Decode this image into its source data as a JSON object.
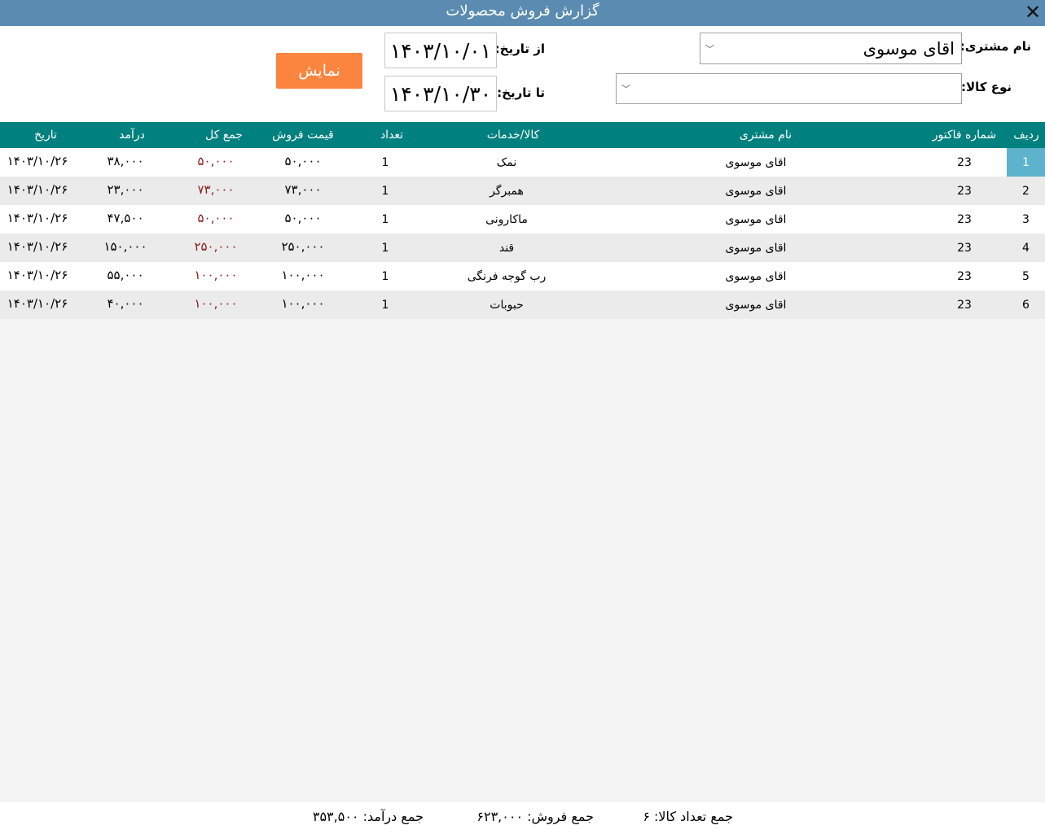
{
  "window": {
    "title": "گزارش فروش محصولات"
  },
  "filters": {
    "customer_label": "نام مشتری:",
    "customer_value": "اقای موسوی",
    "product_type_label": "نوع کالا:",
    "product_type_value": "",
    "from_date_label": "از تاریخ:",
    "from_date_value": "۱۴۰۳/۱۰/۰۱",
    "to_date_label": "تا تاریخ:",
    "to_date_value": "۱۴۰۳/۱۰/۳۰",
    "show_button": "نمایش"
  },
  "table": {
    "columns": {
      "row": "ردیف",
      "invoice": "شماره فاکتور",
      "customer": "نام مشتری",
      "product": "کالا/خدمات",
      "qty": "تعداد",
      "price": "قیمت فروش",
      "total": "جمع کل",
      "income": "درآمد",
      "date": "تاریخ"
    },
    "rows": [
      {
        "row": "1",
        "invoice": "23",
        "customer": "اقای موسوی",
        "product": "نمک",
        "qty": "1",
        "price": "۵۰,۰۰۰",
        "total": "۵۰,۰۰۰",
        "income": "۳۸,۰۰۰",
        "date": "۱۴۰۳/۱۰/۲۶"
      },
      {
        "row": "2",
        "invoice": "23",
        "customer": "اقای موسوی",
        "product": "همبرگر",
        "qty": "1",
        "price": "۷۳,۰۰۰",
        "total": "۷۳,۰۰۰",
        "income": "۲۳,۰۰۰",
        "date": "۱۴۰۳/۱۰/۲۶"
      },
      {
        "row": "3",
        "invoice": "23",
        "customer": "اقای موسوی",
        "product": "ماکارونی",
        "qty": "1",
        "price": "۵۰,۰۰۰",
        "total": "۵۰,۰۰۰",
        "income": "۴۷,۵۰۰",
        "date": "۱۴۰۳/۱۰/۲۶"
      },
      {
        "row": "4",
        "invoice": "23",
        "customer": "اقای موسوی",
        "product": "قند",
        "qty": "1",
        "price": "۲۵۰,۰۰۰",
        "total": "۲۵۰,۰۰۰",
        "income": "۱۵۰,۰۰۰",
        "date": "۱۴۰۳/۱۰/۲۶"
      },
      {
        "row": "5",
        "invoice": "23",
        "customer": "اقای موسوی",
        "product": "رب گوجه فرنگی",
        "qty": "1",
        "price": "۱۰۰,۰۰۰",
        "total": "۱۰۰,۰۰۰",
        "income": "۵۵,۰۰۰",
        "date": "۱۴۰۳/۱۰/۲۶"
      },
      {
        "row": "6",
        "invoice": "23",
        "customer": "اقای موسوی",
        "product": "حبوبات",
        "qty": "1",
        "price": "۱۰۰,۰۰۰",
        "total": "۱۰۰,۰۰۰",
        "income": "۴۰,۰۰۰",
        "date": "۱۴۰۳/۱۰/۲۶"
      }
    ]
  },
  "footer": {
    "count_text": "جمع تعداد کالا: ۶",
    "sales_text": "جمع فروش: ۶۲۳,۰۰۰",
    "income_text": "جمع درآمد: ۳۵۳,۵۰۰"
  },
  "colors": {
    "titlebar": "#5b8bb0",
    "header": "#00807e",
    "button": "#fb843f",
    "selected_cell": "#5db2cc",
    "total_text": "#8b1a1a"
  }
}
